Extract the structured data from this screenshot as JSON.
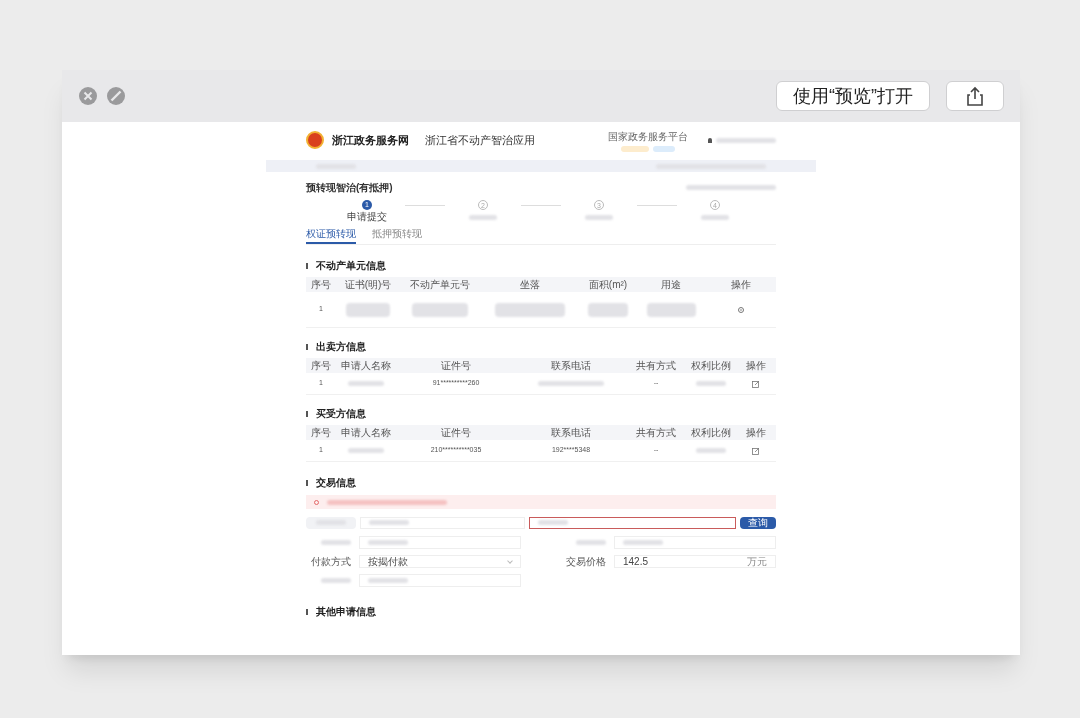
{
  "toolbar": {
    "open_with_button": "使用“预览”打开"
  },
  "header": {
    "site_name": "浙江政务服务网",
    "app_title": "浙江省不动产智治应用",
    "national_platform": "国家政务服务平台"
  },
  "form_title": "预转现智治(有抵押)",
  "steps": [
    {
      "number": "1",
      "label": "申请提交",
      "selected": true
    },
    {
      "number": "2",
      "selected": false
    },
    {
      "number": "3",
      "selected": false
    },
    {
      "number": "4",
      "selected": false
    }
  ],
  "tabs": [
    {
      "label": "权证预转现",
      "selected": true
    },
    {
      "label": "抵押预转现",
      "selected": false
    }
  ],
  "tables": [
    {
      "title": "不动产单元信息",
      "columns": [
        "序号",
        "证书(明)号",
        "不动产单元号",
        "坐落",
        "面积(m²)",
        "用途",
        "操作"
      ],
      "rows": [
        {
          "cells": [
            "1",
            null,
            null,
            null,
            null,
            null
          ],
          "kind": "view"
        }
      ]
    },
    {
      "title": "出卖方信息",
      "columns": [
        "序号",
        "申请人名称",
        "证件号",
        "联系电话",
        "共有方式",
        "权利比例",
        "操作"
      ],
      "rows": [
        {
          "cells": [
            "1",
            null,
            "91**********260",
            null,
            "--",
            null
          ],
          "kind": "edit"
        }
      ]
    },
    {
      "title": "买受方信息",
      "columns": [
        "序号",
        "申请人名称",
        "证件号",
        "联系电话",
        "共有方式",
        "权利比例",
        "操作"
      ],
      "rows": [
        {
          "cells": [
            "1",
            null,
            "210**********035",
            "192****5348",
            "--",
            null
          ],
          "kind": "edit"
        }
      ]
    }
  ],
  "trade": {
    "title": "交易信息",
    "alert": {
      "kind": "error"
    },
    "search_button": "查询",
    "fields": [
      {
        "label": "付款方式",
        "value": "按揭付款",
        "kind": "select"
      },
      {
        "label": "交易价格",
        "value": "142.5",
        "unit": "万元",
        "kind": "text"
      }
    ]
  },
  "other_section": {
    "title": "其他申请信息"
  }
}
